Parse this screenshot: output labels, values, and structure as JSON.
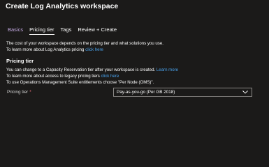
{
  "header": {
    "title": "Create Log Analytics workspace"
  },
  "tabs": [
    {
      "label": "Basics"
    },
    {
      "label": "Pricing tier"
    },
    {
      "label": "Tags"
    },
    {
      "label": "Review + Create"
    }
  ],
  "intro": {
    "line1": "The cost of your workspace depends on the pricing tier and what solutions you use.",
    "line2_prefix": "To learn more about Log Analytics pricing",
    "line2_link": "click here"
  },
  "pricing_section": {
    "heading": "Pricing tier",
    "line1_prefix": "You can change to a Capacity Reservation tier after your workspace is created.",
    "line1_link": "Learn more",
    "line2_prefix": "To learn more about access to legacy pricing tiers",
    "line2_link": "click here",
    "line3": "To use Operations Management Suite entitlements choose \"Per Node (OMS)\"."
  },
  "pricing_field": {
    "label": "Pricing tier",
    "required_marker": "*",
    "selected_value": "Pay-as-you-go (Per GB 2018)"
  },
  "colors": {
    "background": "#1b1a19",
    "link": "#4aa3ee",
    "visited_tab": "#c2a8e0",
    "required": "#f1707b"
  }
}
